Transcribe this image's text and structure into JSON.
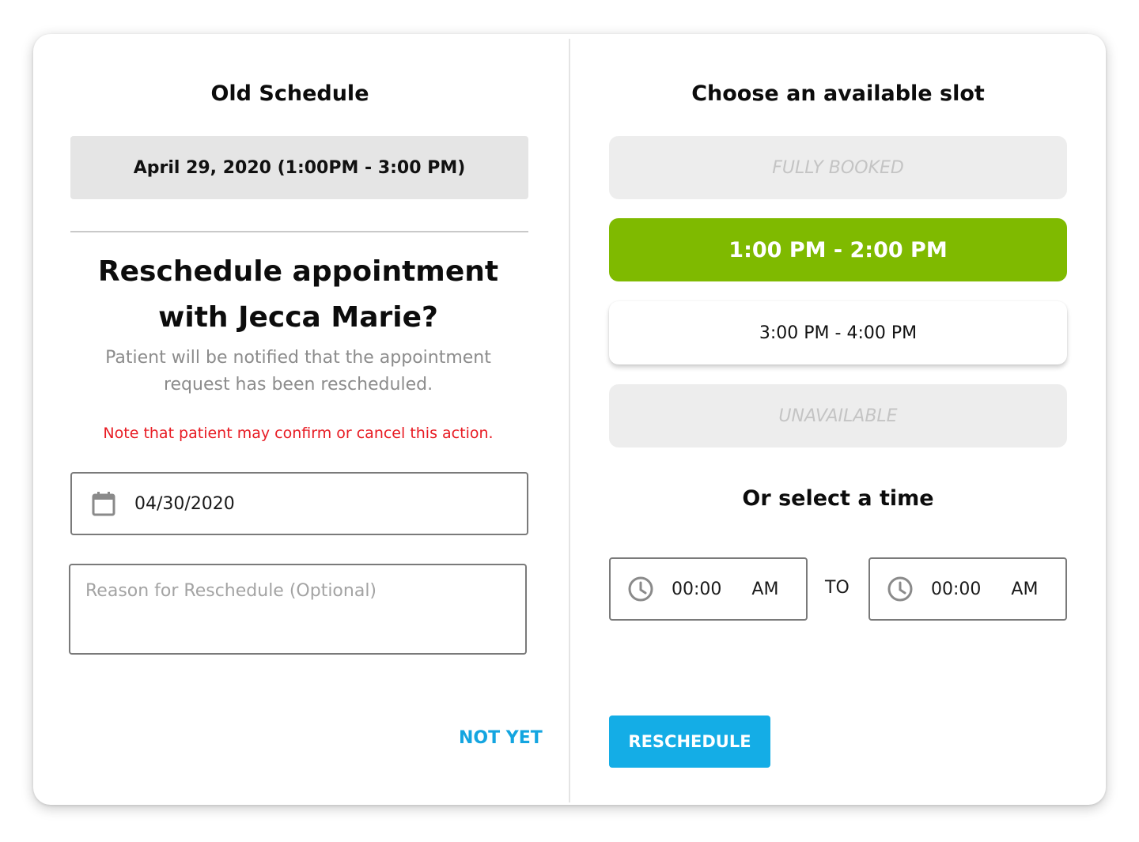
{
  "left": {
    "old_schedule_title": "Old Schedule",
    "old_schedule_value": "April 29, 2020 (1:00PM - 3:00 PM)",
    "headline_line1": "Reschedule appointment",
    "headline_line2": "with Jecca Marie?",
    "subtext_line1": "Patient will be notified that the appointment",
    "subtext_line2": "request has been rescheduled.",
    "note": "Note that patient may confirm or cancel this action.",
    "date_value": "04/30/2020",
    "reason_placeholder": "Reason for Reschedule (Optional)",
    "not_yet_label": "NOT YET"
  },
  "right": {
    "slots_title": "Choose an available slot",
    "slots": [
      {
        "label": "FULLY BOOKED",
        "state": "disabled"
      },
      {
        "label": "1:00 PM - 2:00 PM",
        "state": "selected"
      },
      {
        "label": "3:00 PM - 4:00 PM",
        "state": "available"
      },
      {
        "label": "UNAVAILABLE",
        "state": "disabled"
      }
    ],
    "or_select_title": "Or select a time",
    "from_time": {
      "value": "00:00",
      "ampm": "AM"
    },
    "to_label": "TO",
    "to_time": {
      "value": "00:00",
      "ampm": "AM"
    },
    "reschedule_label": "RESCHEDULE"
  },
  "colors": {
    "selected_slot": "#7fba00",
    "primary_button": "#14ade6",
    "link": "#14a5e0",
    "warning_text": "#e81c24"
  },
  "icons": {
    "date_field": "calendar-icon",
    "time_fields": "clock-icon"
  }
}
